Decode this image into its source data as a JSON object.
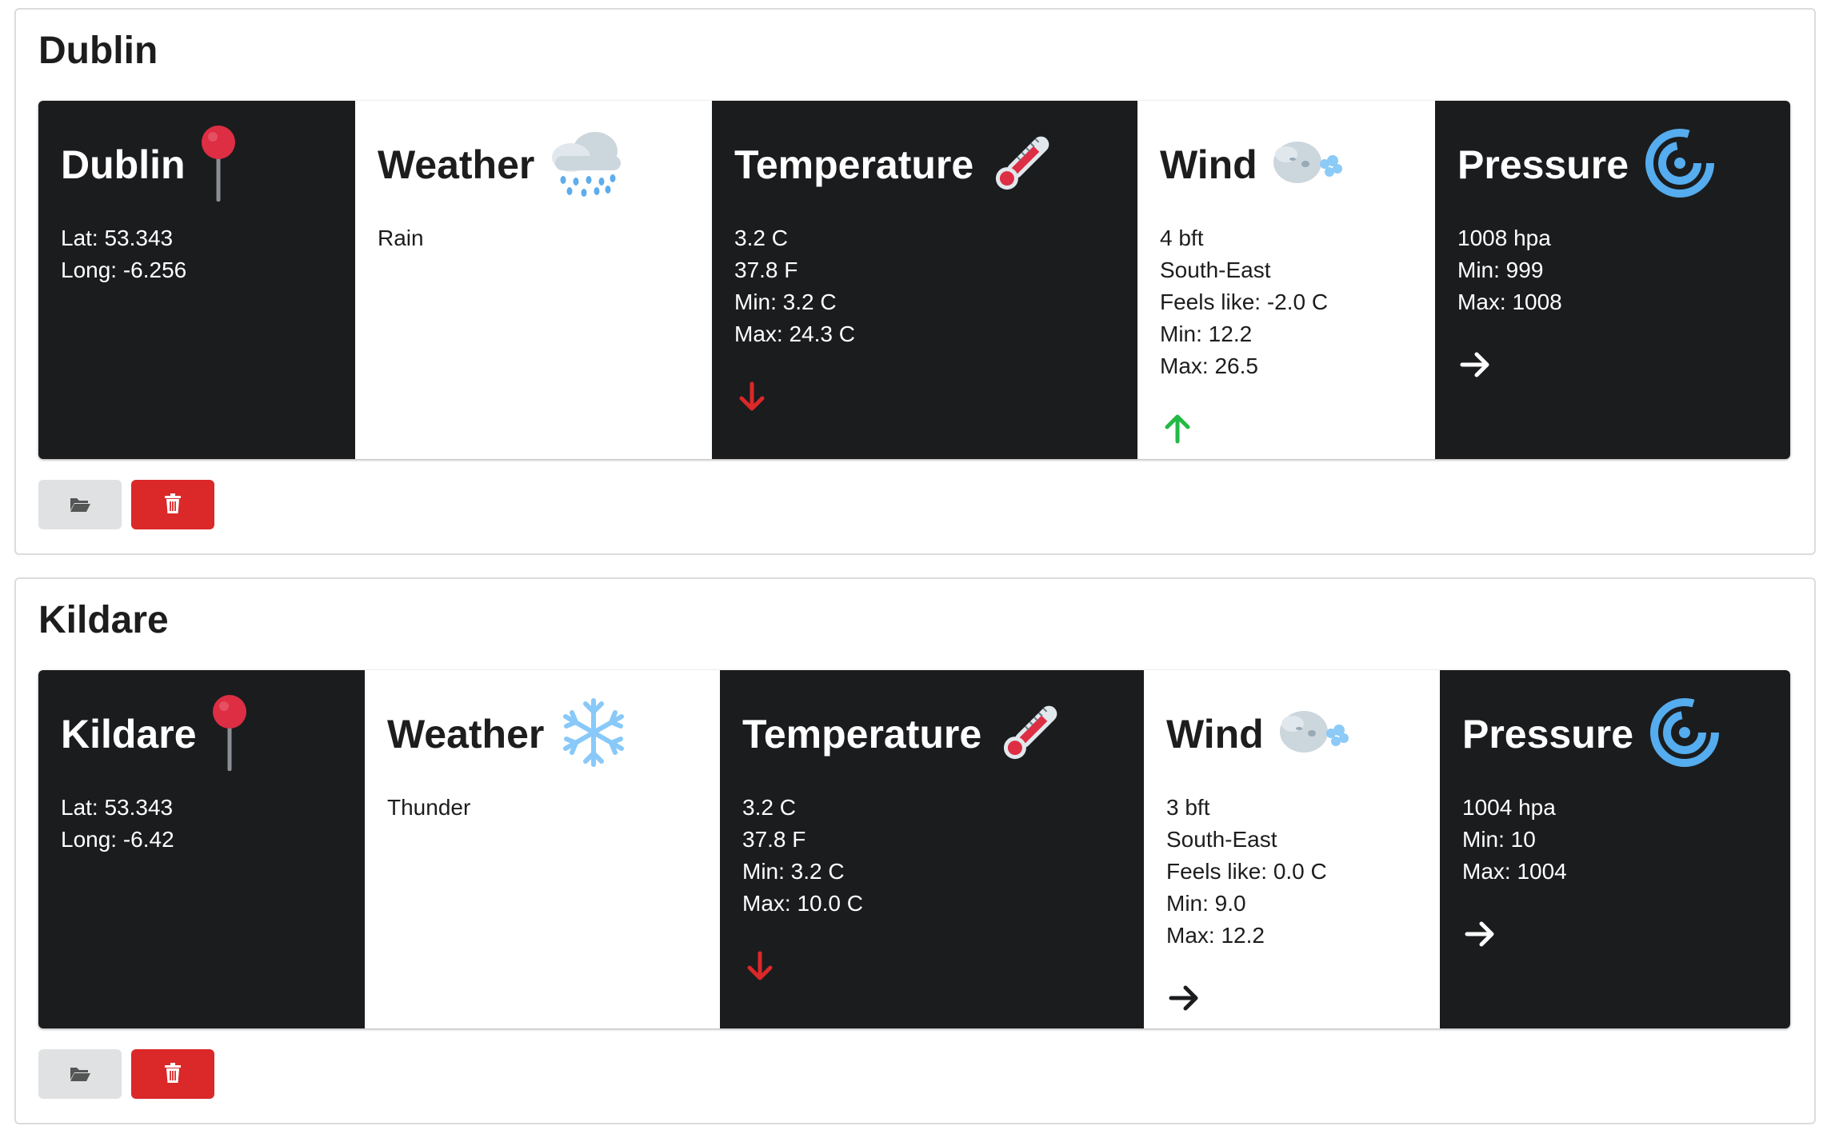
{
  "cards": [
    {
      "title": "Dublin",
      "location": {
        "name": "Dublin",
        "lat": "Lat: 53.343",
        "long": "Long: -6.256",
        "icon": "round-pushpin-icon"
      },
      "weather": {
        "label": "Weather",
        "condition": "Rain",
        "icon": "cloud-with-rain-icon"
      },
      "temperature": {
        "label": "Temperature",
        "celsius": "3.2 C",
        "fahrenheit": "37.8 F",
        "min": "Min: 3.2 C",
        "max": "Max: 24.3 C",
        "trend": "down",
        "icon": "thermometer-icon"
      },
      "wind": {
        "label": "Wind",
        "bft": "4 bft",
        "direction": "South-East",
        "feels_like": "Feels like: -2.0 C",
        "min": "Min: 12.2",
        "max": "Max: 26.5",
        "trend": "up",
        "icon": "wind-face-icon"
      },
      "pressure": {
        "label": "Pressure",
        "hpa": "1008 hpa",
        "min": "Min: 999",
        "max": "Max: 1008",
        "trend": "steady",
        "icon": "cyclone-icon"
      }
    },
    {
      "title": "Kildare",
      "location": {
        "name": "Kildare",
        "lat": "Lat: 53.343",
        "long": "Long: -6.42",
        "icon": "round-pushpin-icon"
      },
      "weather": {
        "label": "Weather",
        "condition": "Thunder",
        "icon": "snowflake-icon"
      },
      "temperature": {
        "label": "Temperature",
        "celsius": "3.2 C",
        "fahrenheit": "37.8 F",
        "min": "Min: 3.2 C",
        "max": "Max: 10.0 C",
        "trend": "down",
        "icon": "thermometer-icon"
      },
      "wind": {
        "label": "Wind",
        "bft": "3 bft",
        "direction": "South-East",
        "feels_like": "Feels like: 0.0 C",
        "min": "Min: 9.0",
        "max": "Max: 12.2",
        "trend": "steady",
        "icon": "wind-face-icon"
      },
      "pressure": {
        "label": "Pressure",
        "hpa": "1004 hpa",
        "min": "Min: 10",
        "max": "Max: 1004",
        "trend": "steady",
        "icon": "cyclone-icon"
      }
    }
  ],
  "buttons": {
    "open_icon": "folder-open-icon",
    "delete_icon": "trash-icon"
  },
  "colors": {
    "dark_panel": "#1b1c1e",
    "trend_down": "#db2828",
    "trend_up": "#21ba45",
    "delete_button": "#db2828",
    "open_button": "#e0e1e2"
  }
}
